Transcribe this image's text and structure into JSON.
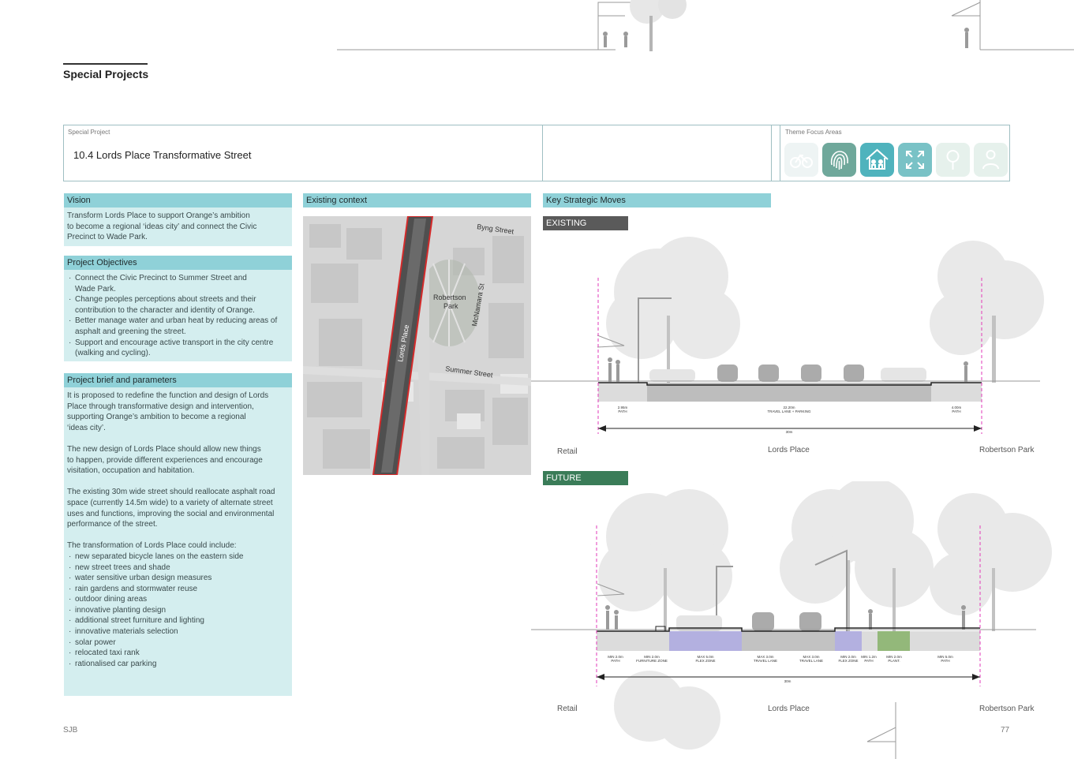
{
  "header": {
    "section_title": "Special Projects"
  },
  "project": {
    "label": "Special Project",
    "title": "10.4  Lords Place Transformative Street",
    "theme_label": "Theme Focus Areas",
    "themes": [
      {
        "icon": "bicycle-icon",
        "active": false,
        "color": "#e6f2f2"
      },
      {
        "icon": "fingerprint-icon",
        "active": true,
        "color": "#6fa89b"
      },
      {
        "icon": "community-house-icon",
        "active": true,
        "color": "#4fb3bd"
      },
      {
        "icon": "expand-arrows-icon",
        "active": true,
        "color": "#79c2c6"
      },
      {
        "icon": "tree-network-icon",
        "active": false,
        "color": "#e4f0ea"
      },
      {
        "icon": "person-icon",
        "active": false,
        "color": "#e4f0ea"
      }
    ]
  },
  "vision": {
    "heading": "Vision",
    "lines": [
      "Transform Lords Place to support Orange’s ambition",
      "to become a regional ‘ideas city’ and connect the Civic",
      "Precinct to Wade Park."
    ]
  },
  "objectives": {
    "heading": "Project Objectives",
    "items": [
      [
        "Connect the Civic Precinct to Summer Street and",
        "Wade Park."
      ],
      [
        "Change peoples perceptions about streets and their",
        "contribution to the character and identity of Orange."
      ],
      [
        "Better manage water and urban heat by reducing areas of",
        "asphalt and greening the street."
      ],
      [
        "Support and encourage active transport in the city centre",
        "(walking and cycling)."
      ]
    ]
  },
  "brief": {
    "heading": "Project brief and parameters",
    "paragraphs": [
      [
        "It is proposed to redefine the function and design of Lords",
        "Place through transformative design and intervention,",
        "supporting Orange’s ambition to become a regional",
        "‘ideas city’."
      ],
      [
        "The new design of Lords Place should allow new things",
        "to happen, provide different experiences and encourage",
        "visitation, occupation and habitation."
      ],
      [
        "The existing 30m wide street should reallocate asphalt road",
        "space (currently 14.5m wide) to a variety of alternate street",
        "uses and functions, improving the social and environmental",
        "performance of the street."
      ]
    ],
    "list_intro": "The transformation of Lords Place could include:",
    "list": [
      "new separated bicycle lanes on the eastern side",
      "new street trees and shade",
      "water sensitive urban design measures",
      "rain gardens and stormwater reuse",
      "outdoor dining areas",
      "innovative planting design",
      "additional street furniture and lighting",
      "innovative materials selection",
      "solar power",
      "relocated taxi rank",
      "rationalised car parking"
    ]
  },
  "context": {
    "heading": "Existing context",
    "map_labels": {
      "byng": "Byng Street",
      "park1": "Robertson",
      "park2": "Park",
      "mcnamara": "McNamara St",
      "lords": "Lords Place",
      "summer": "Summer Street"
    }
  },
  "moves": {
    "heading": "Key Strategic Moves",
    "existing_tag": "EXISTING",
    "future_tag": "FUTURE",
    "existing_dims": [
      [
        "2.95m",
        "PATH"
      ],
      [
        "22.20m",
        "TRAVEL LANE + PARKING"
      ],
      [
        "4.00m",
        "PATH"
      ]
    ],
    "existing_total": "30m",
    "future_dims": [
      [
        "MIN 2.0m",
        "PATH"
      ],
      [
        "MIN 2.0m",
        "FURNITURE ZONE"
      ],
      [
        "MAX 5.0m",
        "FLEX ZONE"
      ],
      [
        "MAX 3.0m",
        "TRAVEL LANE"
      ],
      [
        "MAX 3.0m",
        "TRAVEL LANE"
      ],
      [
        "MIN 2.0m",
        "FLEX ZONE"
      ],
      [
        "MIN 1.2m",
        "PATH"
      ],
      [
        "MIN 2.0m",
        "PLANT."
      ],
      [
        "MIN 5.0m",
        "PATH"
      ]
    ],
    "future_total": "30m",
    "labels": {
      "left": "Retail",
      "center": "Lords Place",
      "right": "Robertson Park"
    },
    "colors": {
      "road": "#c9c9c9",
      "flex": "#b3b0e0",
      "plant": "#93b87a",
      "existing_tag": "#5a5a5a",
      "future_tag": "#3a7c58",
      "boundary": "#e23ab8"
    }
  },
  "footer": {
    "left": "SJB",
    "page": "77"
  }
}
